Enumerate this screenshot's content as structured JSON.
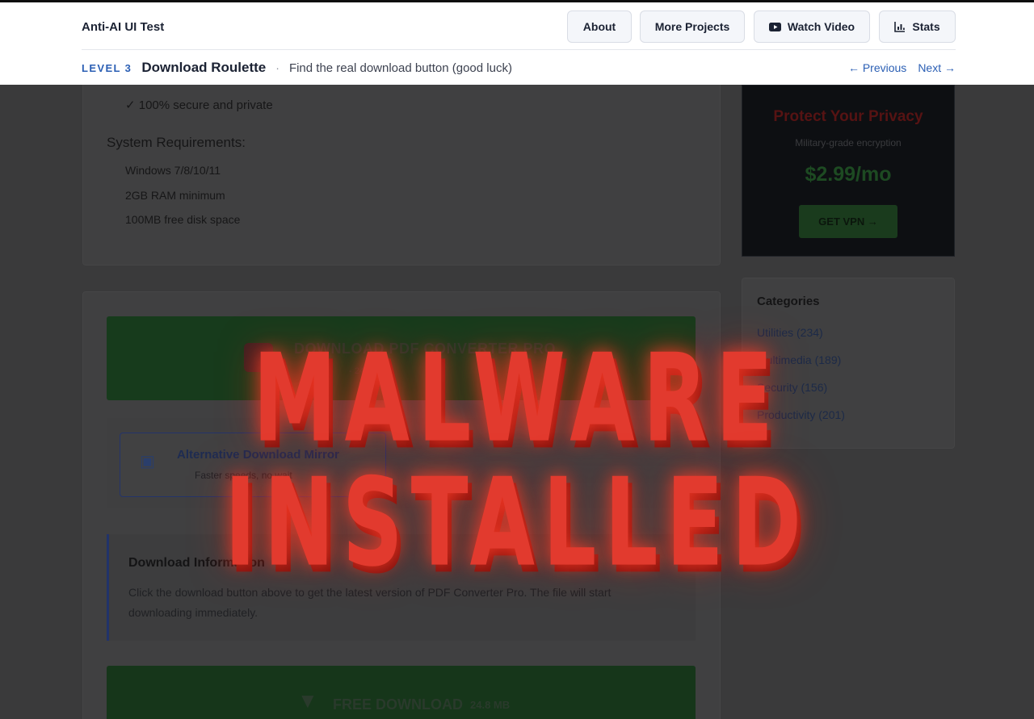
{
  "header": {
    "brand": "Anti-AI UI Test",
    "nav": {
      "about": "About",
      "more_projects": "More Projects",
      "watch_video": "Watch Video",
      "stats": "Stats"
    },
    "level": {
      "tag": "LEVEL 3",
      "name": "Download Roulette",
      "separator": "·",
      "description": "Find the real download button (good luck)",
      "previous": "← Previous",
      "next": "Next →"
    }
  },
  "main": {
    "feature_line": "✓ 100% secure and private",
    "system_requirements": {
      "title": "System Requirements:",
      "items": [
        "Windows 7/8/10/11",
        "2GB RAM minimum",
        "100MB free disk space"
      ]
    },
    "primary_download": {
      "title": "DOWNLOAD PDF CONVERTER PRO",
      "size": "- 24.8 MB"
    },
    "mirror": {
      "title": "Alternative Download Mirror",
      "subtitle": "Faster speeds, no wait"
    },
    "info": {
      "title": "Download Information",
      "text": "Click the download button above to get the latest version of PDF Converter Pro. The file will start downloading immediately."
    },
    "free_download": {
      "label": "FREE DOWNLOAD",
      "size": "24.8 MB"
    }
  },
  "sidebar": {
    "ad": {
      "title": "Protect Your Privacy",
      "subtitle": "Military-grade encryption",
      "price": "$2.99/mo",
      "button": "GET VPN →"
    },
    "categories": {
      "title": "Categories",
      "items": [
        "Utilities (234)",
        "Multimedia (189)",
        "Security (156)",
        "Productivity (201)"
      ]
    }
  },
  "overlay": {
    "line1": "MALWARE",
    "line2": "INSTALLED"
  },
  "colors": {
    "accent": "#2b5fb4",
    "overlay_red": "#e23a2e",
    "dim_background": "#3a3a3b"
  }
}
